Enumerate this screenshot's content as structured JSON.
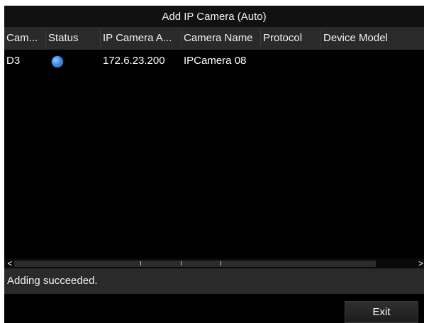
{
  "window": {
    "title": "Add IP Camera (Auto)"
  },
  "table": {
    "columns": [
      "Cam...",
      "Status",
      "IP Camera A...",
      "Camera Name",
      "Protocol",
      "Device Model"
    ],
    "rows": [
      {
        "camera": "D3",
        "status_icon": "status-dot-icon",
        "status_color": "#3d8ff0",
        "ip_address": "172.6.23.200",
        "camera_name": "IPCamera 08",
        "protocol": "",
        "device_model": ""
      }
    ]
  },
  "scrollbar": {
    "left_arrow": "<",
    "right_arrow": ">"
  },
  "status": {
    "message": "Adding succeeded."
  },
  "footer": {
    "exit_label": "Exit"
  }
}
